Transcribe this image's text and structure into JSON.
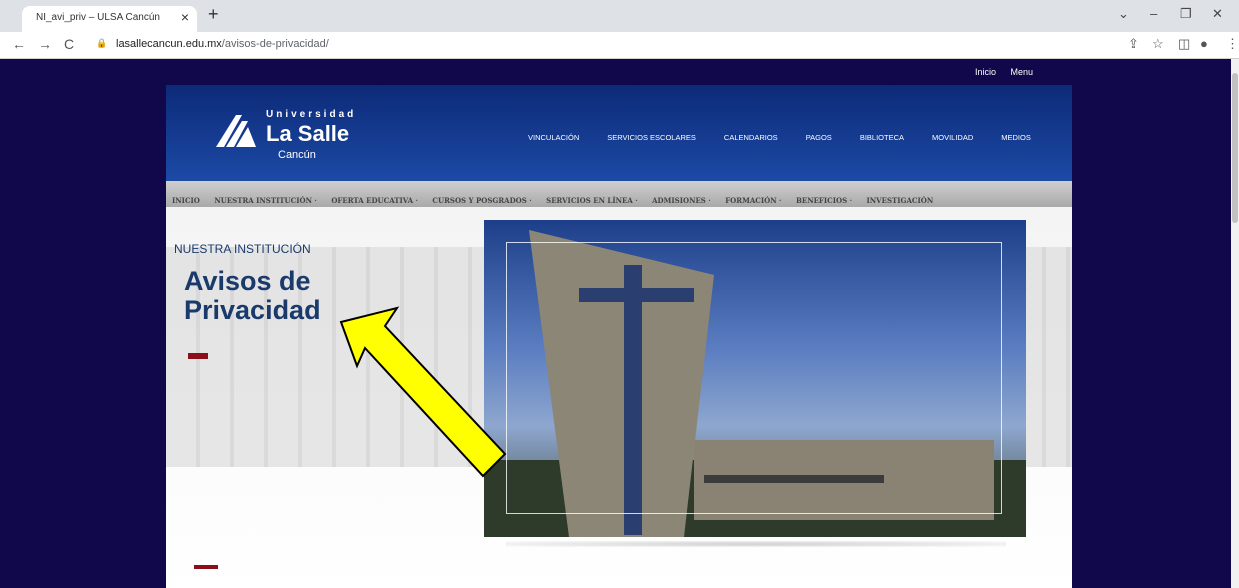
{
  "browser": {
    "tab_title": "NI_avi_priv – ULSA Cancún",
    "url_host": "lasallecancun.edu.mx",
    "url_path": "/avisos-de-privacidad/"
  },
  "site": {
    "top_links": [
      "Inicio",
      "Menu"
    ],
    "logo": {
      "line1": "Universidad",
      "line2": "La Salle",
      "line3": "Cancún"
    },
    "main_nav": [
      "VINCULACIÓN",
      "SERVICIOS ESCOLARES",
      "CALENDARIOS",
      "PAGOS",
      "BIBLIOTECA",
      "MOVILIDAD",
      "MEDIOS"
    ],
    "sub_nav": [
      "INICIO",
      "NUESTRA INSTITUCIÓN ·",
      "OFERTA EDUCATIVA ·",
      "CURSOS Y POSGRADOS ·",
      "SERVICIOS EN LÍNEA ·",
      "ADMISIONES ·",
      "FORMACIÓN ·",
      "BENEFICIOS ·",
      "INVESTIGACIÓN"
    ],
    "kicker": "NUESTRA INSTITUCIÓN",
    "page_title": "Avisos de Privacidad"
  },
  "colors": {
    "brand_blue": "#1b4aa5",
    "page_bg": "#10084a",
    "accent_red": "#8a0f1b",
    "arrow": "#ffff00"
  }
}
